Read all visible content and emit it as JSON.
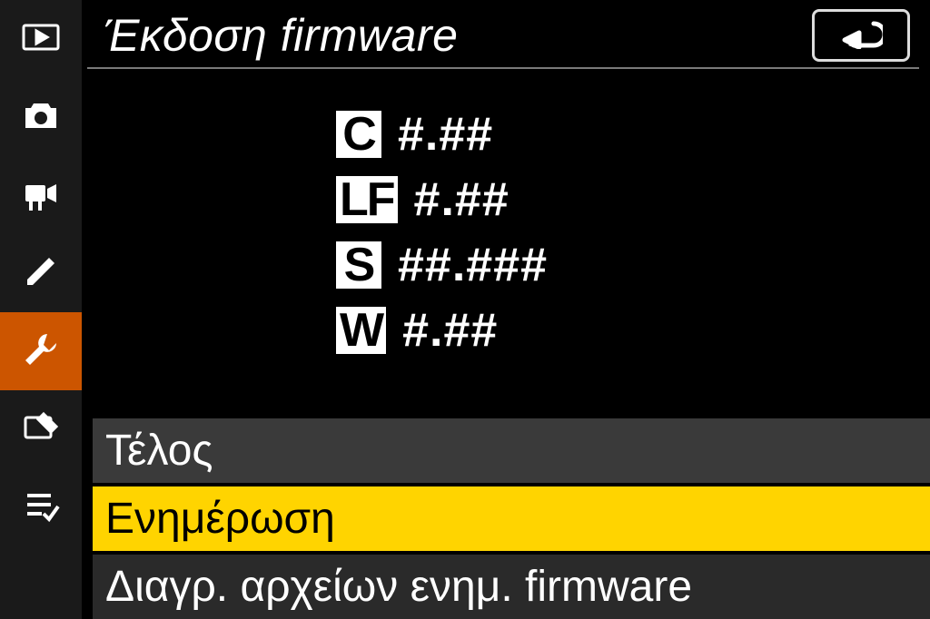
{
  "header": {
    "title": "Έκδοση firmware"
  },
  "sidebar": {
    "items": [
      {
        "name": "playback-icon"
      },
      {
        "name": "photo-icon"
      },
      {
        "name": "video-icon"
      },
      {
        "name": "pencil-icon"
      },
      {
        "name": "wrench-icon"
      },
      {
        "name": "retouch-icon"
      },
      {
        "name": "mymenu-icon"
      }
    ],
    "active_index": 4
  },
  "firmware": [
    {
      "label": "C",
      "value": "#.##"
    },
    {
      "label": "LF",
      "value": "#.##"
    },
    {
      "label": "S",
      "value": "##.###"
    },
    {
      "label": "W",
      "value": "#.##"
    }
  ],
  "options": [
    {
      "label": "Τέλος",
      "selected": false
    },
    {
      "label": "Ενημέρωση",
      "selected": true
    },
    {
      "label": "Διαγρ. αρχείων ενημ. firmware",
      "selected": false
    }
  ]
}
